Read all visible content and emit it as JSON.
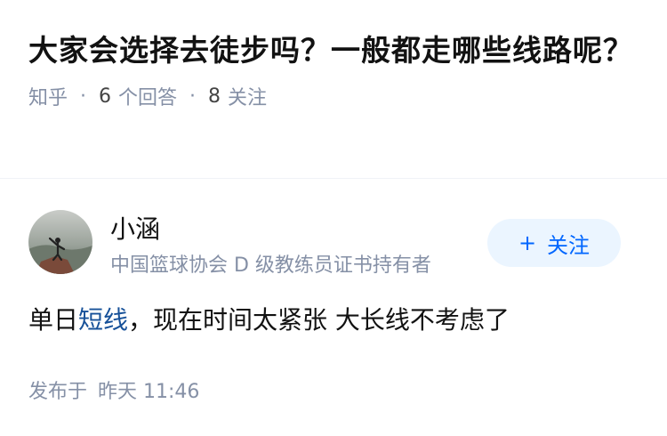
{
  "question": {
    "title": "大家会选择去徒步吗？一般都走哪些线路呢？",
    "source": "知乎",
    "answer_count": "6",
    "answer_label": "个回答",
    "follow_count": "8",
    "follow_label": "关注"
  },
  "answer": {
    "author_name": "小涵",
    "author_bio": "中国篮球协会 D 级教练员证书持有者",
    "follow_button": {
      "icon": "plus-icon",
      "symbol": "+",
      "label": "关注"
    },
    "content_pre": "单日",
    "content_link": "短线",
    "content_post": "，现在时间太紧张 大长线不考虑了",
    "published_label": "发布于",
    "published_time": "昨天 11:46"
  },
  "colors": {
    "primary": "#0066ff",
    "follow_bg": "#ebf5ff",
    "meta_gray": "#8590a6",
    "link": "#175199"
  }
}
